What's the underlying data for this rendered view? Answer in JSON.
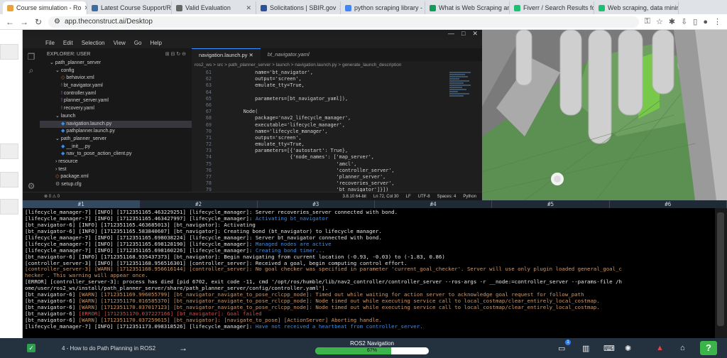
{
  "browser": {
    "tabs": [
      {
        "label": "Course simulation - Ro",
        "color": "#e8a33c",
        "active": true
      },
      {
        "label": "Latest Course Support/ROS",
        "color": "#3a6ea5"
      },
      {
        "label": "Valid Evaluation",
        "color": "#666666"
      },
      {
        "label": "Solicitations | SBIR.gov",
        "color": "#2a5298"
      },
      {
        "label": "python scraping library -",
        "color": "#4285f4"
      },
      {
        "label": "What is Web Scraping and",
        "color": "#0f9d58"
      },
      {
        "label": "Fiverr / Search Results fo",
        "color": "#1dbf73"
      },
      {
        "label": "Web scraping, data minin",
        "color": "#1dbf73"
      }
    ],
    "url": "app.theconstruct.ai/Desktop"
  },
  "vscode": {
    "menu": [
      "File",
      "Edit",
      "Selection",
      "View",
      "Go",
      "Help"
    ],
    "explorer_title": "EXPLORER: USER",
    "tree": [
      {
        "label": "path_planner_server",
        "indent": 1,
        "kind": "folder"
      },
      {
        "label": "config",
        "indent": 2,
        "kind": "folder"
      },
      {
        "label": "behavior.xml",
        "indent": 3,
        "kind": "xml"
      },
      {
        "label": "bt_navigator.yaml",
        "indent": 3,
        "kind": "yaml"
      },
      {
        "label": "controller.yaml",
        "indent": 3,
        "kind": "yaml"
      },
      {
        "label": "planner_server.yaml",
        "indent": 3,
        "kind": "yaml"
      },
      {
        "label": "recovery.yaml",
        "indent": 3,
        "kind": "yaml"
      },
      {
        "label": "launch",
        "indent": 2,
        "kind": "folder"
      },
      {
        "label": "navigation.launch.py",
        "indent": 3,
        "kind": "py",
        "selected": true
      },
      {
        "label": "pathplanner.launch.py",
        "indent": 3,
        "kind": "py"
      },
      {
        "label": "path_planner_server",
        "indent": 2,
        "kind": "folder"
      },
      {
        "label": "__init__.py",
        "indent": 3,
        "kind": "py"
      },
      {
        "label": "nav_to_pose_action_client.py",
        "indent": 3,
        "kind": "py"
      },
      {
        "label": "resource",
        "indent": 2,
        "kind": "folder-closed"
      },
      {
        "label": "test",
        "indent": 2,
        "kind": "folder-closed"
      },
      {
        "label": "package.xml",
        "indent": 2,
        "kind": "xml"
      },
      {
        "label": "setup.cfg",
        "indent": 2,
        "kind": "cfg"
      }
    ],
    "editor_tabs": [
      "navigation.launch.py",
      "bt_navigator.yaml"
    ],
    "breadcrumb": "ros2_ws > src > path_planner_server > launch > navigation.launch.py > generate_launch_description",
    "code": [
      {
        "n": "61",
        "t": "            name='bt_navigator',"
      },
      {
        "n": "62",
        "t": "            output='screen',"
      },
      {
        "n": "63",
        "t": "            emulate_tty=True,"
      },
      {
        "n": "64",
        "t": ""
      },
      {
        "n": "65",
        "t": "            parameters=[bt_navigator_yaml]),"
      },
      {
        "n": "66",
        "t": ""
      },
      {
        "n": "67",
        "t": "        Node("
      },
      {
        "n": "68",
        "t": "            package='nav2_lifecycle_manager',"
      },
      {
        "n": "69",
        "t": "            executable='lifecycle_manager',"
      },
      {
        "n": "70",
        "t": "            name='lifecycle_manager',"
      },
      {
        "n": "71",
        "t": "            output='screen',"
      },
      {
        "n": "72",
        "t": "            emulate_tty=True,"
      },
      {
        "n": "73",
        "t": "            parameters=[{'autostart': True},"
      },
      {
        "n": "74",
        "t": "                        {'node_names': ['map_server',"
      },
      {
        "n": "75",
        "t": "                                        'amcl',"
      },
      {
        "n": "76",
        "t": "                                        'controller_server',"
      },
      {
        "n": "77",
        "t": "                                        'planner_server',"
      },
      {
        "n": "78",
        "t": "                                        'recoveries_server',"
      },
      {
        "n": "79",
        "t": "                                        'bt_navigator']}])"
      },
      {
        "n": "80",
        "t": "        ])"
      }
    ],
    "status": {
      "left": "⊗ 0 ⚠ 0",
      "python_version": "3.8.10 64-bit",
      "position": "Ln 72, Col 30",
      "eol": "LF",
      "encoding": "UTF-8",
      "spaces": "Spaces: 4",
      "language": "Python"
    }
  },
  "shell_tabs": [
    "#1",
    "#2",
    "#3",
    "#4",
    "#5",
    "#6"
  ],
  "terminal": [
    {
      "p": "[lifecycle_manager-7] [INFO] [1712351165.463229251] [lifecycle_manager]: ",
      "m": "Server recoveries_server connected with bond.",
      "c": ""
    },
    {
      "p": "[lifecycle_manager-7] [INFO] [1712351165.463427997] [lifecycle_manager]: ",
      "m": "Activating bt_navigator",
      "c": "b"
    },
    {
      "p": "[bt_navigator-6] [INFO] [1712351165.463685013] [bt_navigator]: ",
      "m": "Activating",
      "c": ""
    },
    {
      "p": "[bt_navigator-6] [INFO] [1712351165.583840607] [bt_navigator]: ",
      "m": "Creating bond (bt_navigator) to lifecycle manager.",
      "c": ""
    },
    {
      "p": "[lifecycle_manager-7] [INFO] [1712351165.698038224] [lifecycle_manager]: ",
      "m": "Server bt_navigator connected with bond.",
      "c": ""
    },
    {
      "p": "[lifecycle_manager-7] [INFO] [1712351165.698128190] [lifecycle_manager]: ",
      "m": "Managed nodes are active",
      "c": "b"
    },
    {
      "p": "[lifecycle_manager-7] [INFO] [1712351165.698160226] [lifecycle_manager]: ",
      "m": "Creating bond timer...",
      "c": "b"
    },
    {
      "p": "[bt_navigator-6] [INFO] [1712351168.935437373] [bt_navigator]: ",
      "m": "Begin navigating from current location (-0.93, -0.03) to (-1.83, 0.86)",
      "c": ""
    },
    {
      "p": "[controller_server-3] [INFO] [1712351168.956516301] [controller_server]: ",
      "m": "Received a goal, begin computing control effort.",
      "c": ""
    },
    {
      "p": "[controller_server-3] [WARN] [1712351168.956616144] [controller_server]: ",
      "m": "No goal checker was specified in parameter 'current_goal_checker'. Server will use only plugin loaded general_goal_c",
      "c": "w"
    },
    {
      "p": "hecker . This warning will appear once.",
      "m": "",
      "c": "w"
    },
    {
      "p": "[ERROR] [controller_server-3]: process has died [pid 6702, exit code -11, cmd '/opt/ros/humble/lib/nav2_controller/controller_server --ros-args -r __node:=controller_server --params-file /h",
      "m": "",
      "c": ""
    },
    {
      "p": "ome/user/ros2_ws/install/path_planner_server/share/path_planner_server/config/controller.yaml'].",
      "m": "",
      "c": ""
    },
    {
      "p": "[bt_navigator-6] ",
      "m": "[WARN] [1712351169.996055799] [bt_navigator_navigate_to_pose_rclcpp_node]: Timed out while waiting for action server to acknowledge goal request for follow_path",
      "c": "w"
    },
    {
      "p": "[bt_navigator-6] ",
      "m": "[WARN] [1712351170.016585370] [bt_navigator_navigate_to_pose_rclcpp_node]: Node timed out while executing service call to local_costmap/clear_entirely_local_costmap.",
      "c": "w"
    },
    {
      "p": "[bt_navigator-6] ",
      "m": "[WARN] [1712351170.037017123] [bt_navigator_navigate_to_pose_rclcpp_node]: Node timed out while executing service call to local_costmap/clear_entirely_local_costmap.",
      "c": "w"
    },
    {
      "p": "[bt_navigator-6] ",
      "m": "[ERROR] [1712351170.037227166] [bt_navigator]: Goal failed",
      "c": "r"
    },
    {
      "p": "[bt_navigator-6] ",
      "m": "[WARN] [1712351170.037259615] [bt_navigator]: [navigate_to_pose] [ActionServer] Aborting handle.",
      "c": "w"
    },
    {
      "p": "[lifecycle_manager-7] [INFO] [1712351173.098318526] [lifecycle_manager]: ",
      "m": "Have not received a heartbeat from controller_server.",
      "c": "b"
    }
  ],
  "bottom": {
    "unit_title": "4 - How to do Path Planning in ROS2",
    "progress_title": "ROS2 Navigation",
    "progress_label": "67%",
    "progress": 0.67,
    "notification_count": "1",
    "help": "?"
  }
}
